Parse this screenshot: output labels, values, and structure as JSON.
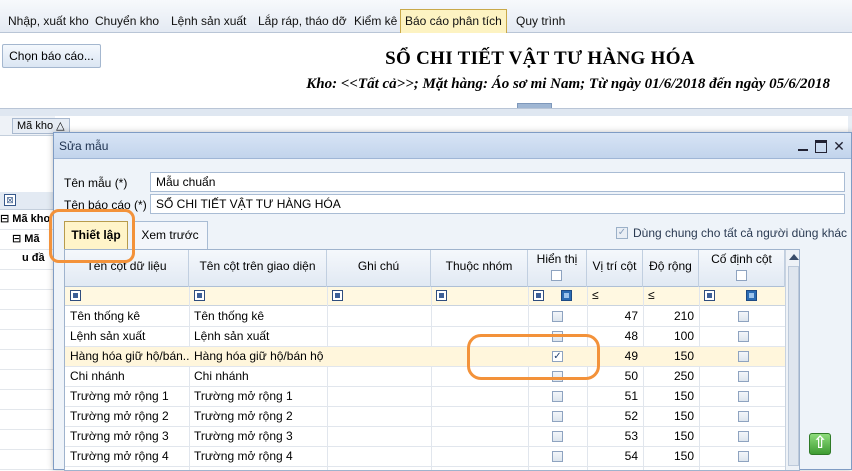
{
  "menu": {
    "tabs": [
      {
        "label": "Nhập, xuất kho"
      },
      {
        "label": "Chuyển kho"
      },
      {
        "label": "Lệnh sản xuất"
      },
      {
        "label": "Lắp ráp, tháo dỡ"
      },
      {
        "label": "Kiểm kê"
      },
      {
        "label": "Báo cáo phân tích"
      },
      {
        "label": "Quy trình"
      }
    ],
    "active": "Báo cáo phân tích"
  },
  "report": {
    "choose_button": "Chọn báo cáo...",
    "title": "SỔ CHI TIẾT VẬT TƯ HÀNG HÓA",
    "subtitle": "Kho: <<Tất cả>>; Mặt hàng: Áo sơ mi Nam; Từ ngày 01/6/2018 đến ngày 05/6/2018"
  },
  "background_grid": {
    "col_button": "Mã kho",
    "group1": "Mã kho",
    "group2": "Mã",
    "group3": "u đầ"
  },
  "dialog": {
    "title": "Sửa mẫu",
    "template_name_label": "Tên mẫu (*)",
    "template_name_value": "Mẫu chuẩn",
    "report_name_label": "Tên báo cáo (*)",
    "report_name_value": "SỔ CHI TIẾT VẬT TƯ HÀNG HÓA",
    "tab_setup": "Thiết lập",
    "tab_preview": "Xem trước",
    "share_label": "Dùng chung cho tất cả người dùng khác",
    "share_checked": true
  },
  "grid": {
    "columns": {
      "data_name": "Tên cột dữ liệu",
      "ui_name": "Tên cột trên giao diện",
      "note": "Ghi chú",
      "group": "Thuộc nhóm",
      "visible": "Hiển thị",
      "position": "Vị trí cột",
      "width": "Độ rộng",
      "fixed": "Cố định cột"
    },
    "filter_ops": {
      "position": "≤",
      "width": "≤"
    },
    "rows": [
      {
        "data_name": "Tên thống kê",
        "ui_name": "Tên thống kê",
        "visible": false,
        "position": "47",
        "width": "210"
      },
      {
        "data_name": "Lệnh sản xuất",
        "ui_name": "Lệnh sản xuất",
        "visible": false,
        "position": "48",
        "width": "100"
      },
      {
        "data_name": "Hàng hóa giữ hộ/bán...",
        "ui_name": "Hàng hóa giữ hộ/bán hộ",
        "visible": true,
        "position": "49",
        "width": "150",
        "selected": true
      },
      {
        "data_name": "Chi nhánh",
        "ui_name": "Chi nhánh",
        "visible": false,
        "position": "50",
        "width": "250"
      },
      {
        "data_name": "Trường mở rộng 1",
        "ui_name": "Trường mở rộng 1",
        "visible": false,
        "position": "51",
        "width": "150"
      },
      {
        "data_name": "Trường mở rộng 2",
        "ui_name": "Trường mở rộng 2",
        "visible": false,
        "position": "52",
        "width": "150"
      },
      {
        "data_name": "Trường mở rộng 3",
        "ui_name": "Trường mở rộng 3",
        "visible": false,
        "position": "53",
        "width": "150"
      },
      {
        "data_name": "Trường mở rộng 4",
        "ui_name": "Trường mở rộng 4",
        "visible": false,
        "position": "54",
        "width": "150"
      }
    ]
  },
  "colors": {
    "highlight": "#f3923a",
    "active_tab": "#fdf3c2",
    "selected_row": "#fff6dc"
  },
  "icons": {
    "up": "arrow-up-icon",
    "filter": "filter-icon",
    "checkbox": "checkbox-icon"
  }
}
